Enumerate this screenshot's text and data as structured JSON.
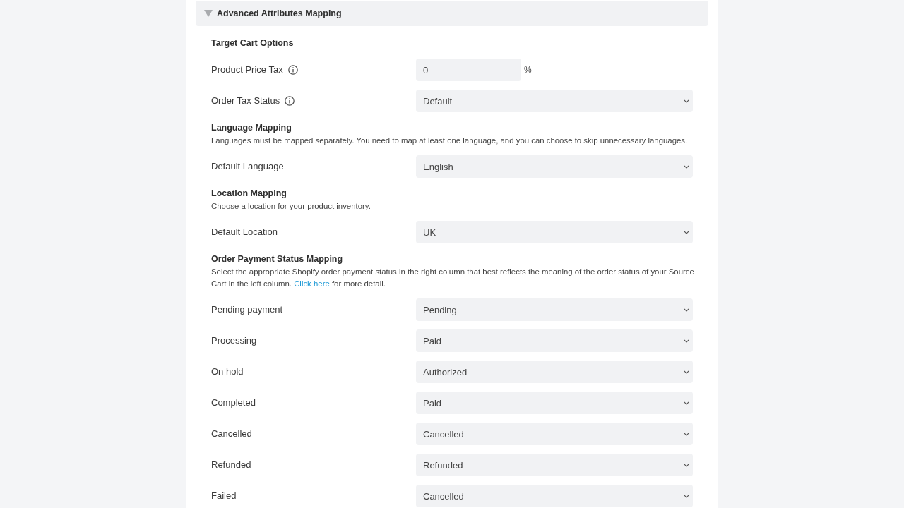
{
  "section": {
    "title": "Advanced Attributes Mapping",
    "expanded": true
  },
  "groups": [
    {
      "heading": "Target Cart Options",
      "fields": [
        {
          "kind": "text",
          "label": "Product Price Tax",
          "info": true,
          "value": "0",
          "unit": "%"
        },
        {
          "kind": "select",
          "label": "Order Tax Status",
          "info": true,
          "value": "Default"
        }
      ]
    },
    {
      "heading": "Language Mapping",
      "description": "Languages must be mapped separately. You need to map at least one language, and you can choose to skip unnecessary languages.",
      "fields": [
        {
          "kind": "select",
          "label": "Default Language",
          "info": false,
          "value": "English"
        }
      ]
    },
    {
      "heading": "Location Mapping",
      "description": "Choose a location for your product inventory.",
      "fields": [
        {
          "kind": "select",
          "label": "Default Location",
          "info": false,
          "value": "UK"
        }
      ]
    },
    {
      "heading": "Order Payment Status Mapping",
      "description": "Select the appropriate Shopify order payment status in the right column that best reflects the meaning of the order status of your Source Cart in the left column.",
      "link": "Click here",
      "description_end": "for more detail.",
      "fields": [
        {
          "kind": "select",
          "label": "Pending payment",
          "info": false,
          "value": "Pending"
        },
        {
          "kind": "select",
          "label": "Processing",
          "info": false,
          "value": "Paid"
        },
        {
          "kind": "select",
          "label": "On hold",
          "info": false,
          "value": "Authorized"
        },
        {
          "kind": "select",
          "label": "Completed",
          "info": false,
          "value": "Paid"
        },
        {
          "kind": "select",
          "label": "Cancelled",
          "info": false,
          "value": "Cancelled"
        },
        {
          "kind": "select",
          "label": "Refunded",
          "info": false,
          "value": "Refunded"
        },
        {
          "kind": "select",
          "label": "Failed",
          "info": false,
          "value": "Cancelled"
        }
      ]
    }
  ]
}
